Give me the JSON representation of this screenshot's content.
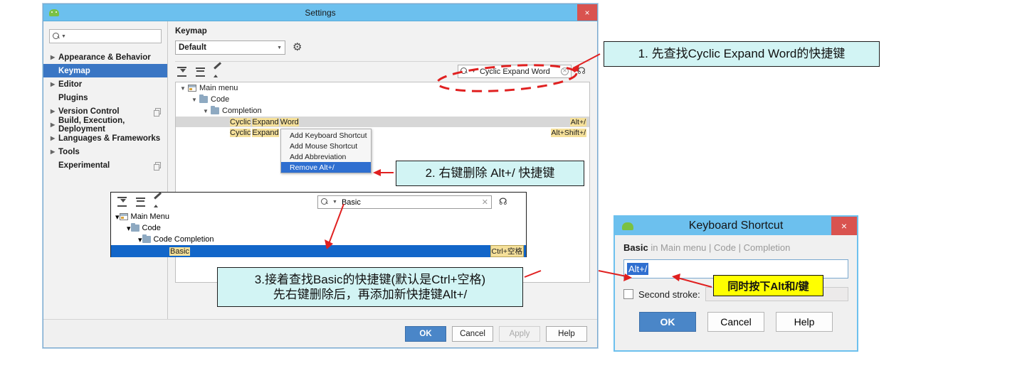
{
  "settings_window": {
    "title": "Settings",
    "close_label": "×",
    "app_icon": "android-robot-icon",
    "sidebar": {
      "search_placeholder": "",
      "search_value": "",
      "items": [
        {
          "label": "Appearance & Behavior",
          "expandable": true,
          "selected": false,
          "copy_icon": false
        },
        {
          "label": "Keymap",
          "expandable": false,
          "selected": true,
          "copy_icon": false
        },
        {
          "label": "Editor",
          "expandable": true,
          "selected": false,
          "copy_icon": false
        },
        {
          "label": "Plugins",
          "expandable": false,
          "selected": false,
          "copy_icon": false
        },
        {
          "label": "Version Control",
          "expandable": true,
          "selected": false,
          "copy_icon": true
        },
        {
          "label": "Build, Execution, Deployment",
          "expandable": true,
          "selected": false,
          "copy_icon": false
        },
        {
          "label": "Languages & Frameworks",
          "expandable": true,
          "selected": false,
          "copy_icon": false
        },
        {
          "label": "Tools",
          "expandable": true,
          "selected": false,
          "copy_icon": false
        },
        {
          "label": "Experimental",
          "expandable": false,
          "selected": false,
          "copy_icon": true
        }
      ]
    },
    "main": {
      "heading": "Keymap",
      "keymap_select_value": "Default",
      "gear_icon": "gear-icon",
      "toolbar_icons": [
        "expand-all-icon",
        "collapse-all-icon",
        "edit-shortcut-icon"
      ],
      "search": {
        "value": "Cyclic Expand Word",
        "clear_icon": "clear-icon",
        "filter_icon": "filter-icon"
      },
      "tree": {
        "nodes": [
          {
            "label": "Main menu",
            "depth": 0,
            "icon": "main-menu-icon",
            "expanded": true
          },
          {
            "label": "Code",
            "depth": 1,
            "icon": "folder-icon",
            "expanded": true
          },
          {
            "label": "Completion",
            "depth": 2,
            "icon": "folder-icon",
            "expanded": true
          }
        ],
        "actions": [
          {
            "label": "Cyclic Expand Word",
            "shortcut": "Alt+/",
            "selected": true
          },
          {
            "label": "Cyclic Expand W",
            "shortcut": "Alt+Shift+/",
            "selected": false
          }
        ]
      },
      "context_menu": {
        "items": [
          {
            "label": "Add Keyboard Shortcut",
            "active": false
          },
          {
            "label": "Add Mouse Shortcut",
            "active": false
          },
          {
            "label": "Add Abbreviation",
            "active": false
          },
          {
            "label": "Remove Alt+/",
            "active": true
          }
        ]
      }
    },
    "footer_buttons": [
      {
        "label": "OK",
        "style": "primary"
      },
      {
        "label": "Cancel",
        "style": "normal"
      },
      {
        "label": "Apply",
        "style": "disabled"
      },
      {
        "label": "Help",
        "style": "normal"
      }
    ]
  },
  "float_panel": {
    "toolbar_icons": [
      "expand-all-icon",
      "collapse-all-icon",
      "edit-shortcut-icon"
    ],
    "search": {
      "value": "Basic",
      "clear_icon": "clear-icon",
      "filter_icon": "filter-icon"
    },
    "nodes": [
      {
        "label": "Main Menu",
        "depth": 0,
        "icon": "main-menu-icon"
      },
      {
        "label": "Code",
        "depth": 1,
        "icon": "folder-icon"
      },
      {
        "label": "Code Completion",
        "depth": 2,
        "icon": "folder-icon"
      }
    ],
    "selected_action": {
      "label": "Basic",
      "shortcut": "Ctrl+空格"
    }
  },
  "keyboard_shortcut_dialog": {
    "title": "Keyboard Shortcut",
    "close_label": "×",
    "app_icon": "android-robot-icon",
    "context_bold": "Basic",
    "context_rest": " in Main menu | Code | Completion",
    "shortcut_value": "Alt+/",
    "second_stroke_label": "Second stroke:",
    "second_stroke_checked": false,
    "second_stroke_value": "",
    "buttons": [
      {
        "label": "OK",
        "style": "primary"
      },
      {
        "label": "Cancel",
        "style": "normal"
      },
      {
        "label": "Help",
        "style": "normal"
      }
    ]
  },
  "annotations": {
    "note1": "1. 先查找Cyclic Expand Word的快捷键",
    "note2": "2. 右键删除 Alt+/ 快捷键",
    "note3_line1": "3.接着查找Basic的快捷键(默认是Ctrl+空格)",
    "note3_line2": "先右键删除后，再添加新快捷键Alt+/",
    "note_yellow": "同时按下Alt和/键"
  },
  "colors": {
    "title_bar": "#6cc0ee",
    "close_button": "#d9534f",
    "selection_blue": "#3a76c4",
    "highlight_yellow": "#f5e09a",
    "note_cyan": "#d2f4f4",
    "note_yellow": "#ffff00",
    "arrow_red": "#e02020"
  }
}
